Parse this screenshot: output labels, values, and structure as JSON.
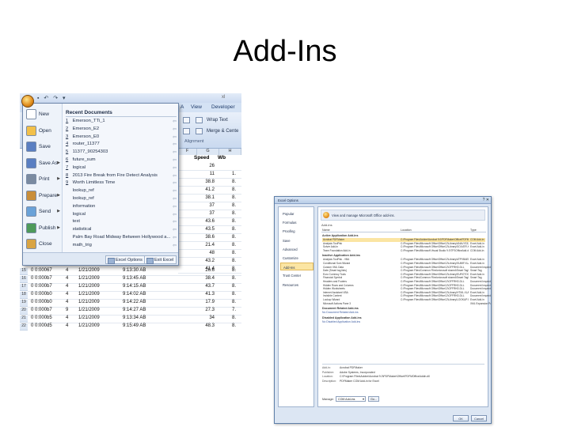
{
  "slide": {
    "title": "Add-Ins"
  },
  "excel": {
    "window_title": "xl",
    "ribbon_tabs": [
      "A",
      "View",
      "Developer"
    ],
    "ribbon_buttons": {
      "wrap_text": "Wrap Text",
      "merge_center": "Merge & Cente",
      "alignment": "Alignment"
    },
    "columns": [
      "F",
      "G",
      "H"
    ],
    "sheet_headers": [
      "Speed",
      "Wb"
    ],
    "office_menu": {
      "items": [
        {
          "label": "New",
          "icon": "new-icon",
          "arrow": false
        },
        {
          "label": "Open",
          "icon": "open-folder-icon",
          "arrow": false
        },
        {
          "label": "Save",
          "icon": "save-icon",
          "arrow": false
        },
        {
          "label": "Save As",
          "icon": "save-as-icon",
          "arrow": true
        },
        {
          "label": "Print",
          "icon": "print-icon",
          "arrow": true
        },
        {
          "label": "Prepare",
          "icon": "prepare-icon",
          "arrow": true
        },
        {
          "label": "Send",
          "icon": "send-icon",
          "arrow": true
        },
        {
          "label": "Publish",
          "icon": "publish-icon",
          "arrow": true
        },
        {
          "label": "Close",
          "icon": "close-document-icon",
          "arrow": false
        }
      ],
      "recent_header": "Recent Documents",
      "recent": [
        {
          "num": "1",
          "name": "Emerson_TTi_1"
        },
        {
          "num": "2",
          "name": "Emerson_E2"
        },
        {
          "num": "3",
          "name": "Emerson_E0"
        },
        {
          "num": "4",
          "name": "router_11377"
        },
        {
          "num": "5",
          "name": "11377_90254303"
        },
        {
          "num": "6",
          "name": "future_sum"
        },
        {
          "num": "7",
          "name": "logical"
        },
        {
          "num": "8",
          "name": "2013 Fire Break from Fire Detect Analysis"
        },
        {
          "num": "9",
          "name": "Worth Limitless Time"
        },
        {
          "num": "",
          "name": "lookup_ref"
        },
        {
          "num": "",
          "name": "lookup_ref"
        },
        {
          "num": "",
          "name": "information"
        },
        {
          "num": "",
          "name": "logical"
        },
        {
          "num": "",
          "name": "text"
        },
        {
          "num": "",
          "name": "statistical"
        },
        {
          "num": "",
          "name": "Palm Bay Road Midway Between Hollywood a..."
        },
        {
          "num": "",
          "name": "math_trig"
        }
      ],
      "excel_options": "Excel Options",
      "exit_excel": "Exit Excel"
    },
    "grid_rows_right": [
      [
        "26",
        ""
      ],
      [
        "11",
        "1."
      ],
      [
        "38.8",
        "8."
      ],
      [
        "41.2",
        "8."
      ],
      [
        "38.1",
        "8."
      ],
      [
        "37",
        "8."
      ],
      [
        "37",
        "8."
      ],
      [
        "43.6",
        "8."
      ],
      [
        "43.5",
        "8."
      ],
      [
        "38.6",
        "8."
      ],
      [
        "21.4",
        "8."
      ],
      [
        "48",
        "8."
      ],
      [
        "43.2",
        "8."
      ],
      [
        "41.4",
        "8."
      ]
    ],
    "grid_rows_bottom": [
      [
        "15",
        "0 0:00067",
        "4",
        "1/21/2009",
        "9:13:30 AB",
        "26.6",
        "8."
      ],
      [
        "16",
        "0 0:000b7",
        "4",
        "1/21/2009",
        "9:13:45 AB",
        "38.4",
        "8."
      ],
      [
        "17",
        "0 0:000b7",
        "4",
        "1/21/2009",
        "9:14:15 AB",
        "43.7",
        "8."
      ],
      [
        "18",
        "0 0:000b0",
        "4",
        "1/21/2009",
        "9:14:02 AB",
        "41.3",
        "8."
      ],
      [
        "19",
        "0 0:000b0",
        "4",
        "1/21/2009",
        "9:14:22 AB",
        "17.9",
        "8."
      ],
      [
        "20",
        "0 0:000b7",
        "9",
        "1/21/2009",
        "9:14:27 AB",
        "27.3",
        "7."
      ],
      [
        "21",
        "0 0:000b5",
        "4",
        "1/21/2009",
        "9:13:34 AB",
        "34",
        "8."
      ],
      [
        "22",
        "0 0:000d5",
        "4",
        "1/21/2009",
        "9:15:49 AB",
        "48.3",
        "8."
      ]
    ]
  },
  "options_dialog": {
    "title": "Excel Options",
    "nav": [
      "Popular",
      "Formulas",
      "Proofing",
      "Save",
      "Advanced",
      "Customize",
      "Add-Ins",
      "Trust Center",
      "Resources"
    ],
    "selected_nav": "Add-Ins",
    "header_text": "View and manage Microsoft Office add-ins.",
    "sub_label": "Add-ins",
    "columns": [
      "Name",
      "Location",
      "Type"
    ],
    "sections": [
      {
        "title": "Active Application Add-ins",
        "rows": [
          [
            "Acrobat PDFMaker",
            "C:\\Program Files\\Adobe\\Acrobat 9.0\\PDFMaker\\Office\\PDFMOfficeAddin.dll",
            "COM Add-in"
          ],
          [
            "Analysis ToolPak",
            "C:\\Program Files\\Microsoft Office\\Office12\\Library\\ANALYS32.XLL",
            "Excel Add-in"
          ],
          [
            "Solver Add-in",
            "C:\\Program Files\\Microsoft Office\\Office12\\Library\\SOLVER.XLAM",
            "Excel Add-in"
          ],
          [
            "Team Foundation Add-in",
            "C:\\Program Files\\Microsoft Visual Studio 9.0\\TFSOfficeAdd.dll",
            "COM Add-in"
          ]
        ]
      },
      {
        "title": "Inactive Application Add-ins",
        "rows": [
          [
            "Analysis ToolPak - VBA",
            "C:\\Program Files\\Microsoft Office\\Office12\\Library\\ATPVBAEN.XLAM",
            "Excel Add-in"
          ],
          [
            "Conditional Sum Wizard",
            "C:\\Program Files\\Microsoft Office\\Office12\\Library\\SUMIF.XLAM",
            "Excel Add-in"
          ],
          [
            "Custom XML Data",
            "C:\\Program Files\\Microsoft Office\\Office12\\OFFRHD.DLL",
            "Document Inspector"
          ],
          [
            "Date (Smart tag lists)",
            "C:\\Program Files\\Common Files\\microsoft shared\\Smart Tag\\MOFL.DLL",
            "Smart Tag"
          ],
          [
            "Euro Currency Tools",
            "C:\\Program Files\\Microsoft Office\\Office12\\Library\\EUROTOOL.XLAM",
            "Excel Add-in"
          ],
          [
            "Financial Symbol",
            "C:\\Program Files\\Common Files\\microsoft shared\\Smart Tag\\FSTOCK.DLL",
            "Smart Tag"
          ],
          [
            "Headers and Footers",
            "C:\\Program Files\\Microsoft Office\\Office12\\OFFRHD.DLL",
            "Document Inspector"
          ],
          [
            "Hidden Rows and Columns",
            "C:\\Program Files\\Microsoft Office\\Office12\\OFFRHD.DLL",
            "Document Inspector"
          ],
          [
            "Hidden Worksheets",
            "C:\\Program Files\\Microsoft Office\\Office12\\OFFRHD.DLL",
            "Document Inspector"
          ],
          [
            "Internet Assistant VBA",
            "C:\\Program Files\\Microsoft Office\\Office12\\Library\\HTML.XLAM",
            "Excel Add-in"
          ],
          [
            "Invisible Content",
            "C:\\Program Files\\Microsoft Office\\Office12\\OFFRHD.DLL",
            "Document Inspector"
          ],
          [
            "Lookup Wizard",
            "C:\\Program Files\\Microsoft Office\\Office12\\Library\\LOOKUP.XLAM",
            "Excel Add-in"
          ],
          [
            "Microsoft Actions Pane 3",
            "",
            "XML Expansion Pack"
          ]
        ]
      }
    ],
    "doc_section": {
      "title": "Document Related Add-ins",
      "empty": "No Document Related Add-ins"
    },
    "disabled_section": {
      "title": "Disabled Application Add-ins",
      "empty": "No Disabled Application Add-ins"
    },
    "details": [
      {
        "label": "Add-in:",
        "value": "Acrobat PDFMaker"
      },
      {
        "label": "Publisher:",
        "value": "Adobe Systems, Incorporated"
      },
      {
        "label": "Location:",
        "value": "C:\\Program Files\\Adobe\\Acrobat 9.0\\PDFMaker\\Office\\PDFMOfficeAddin.dll"
      },
      {
        "label": "Description:",
        "value": "PDFMaker COM Add-in for Excel"
      }
    ],
    "manage_label": "Manage:",
    "manage_value": "COM Add-ins",
    "go_label": "Go...",
    "ok_label": "OK",
    "cancel_label": "Cancel"
  }
}
